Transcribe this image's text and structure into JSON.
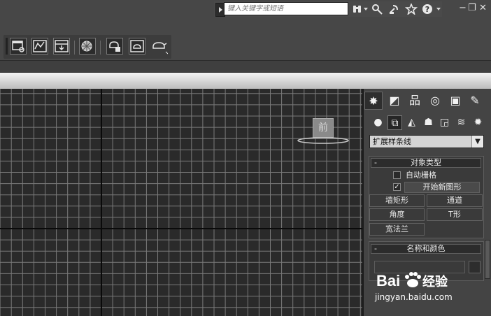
{
  "infocenter": {
    "search_placeholder": "键入关键字或短语",
    "icons": [
      "binoculars-icon",
      "key-icon",
      "satellite-icon",
      "star-icon",
      "help-icon"
    ],
    "help_glyph": "?"
  },
  "window_controls": {
    "minimize": "−",
    "restore": "❐",
    "close": "✕"
  },
  "toolbar": {
    "icons": [
      "scene-explorer-icon",
      "curve-editor-icon",
      "schematic-view-icon",
      "material-editor-icon",
      "render-setup-icon",
      "rendered-frame-icon",
      "render-icon"
    ]
  },
  "viewport": {
    "gizmo_label": "前",
    "background": "#2a2a2a",
    "grid_color": "#7a7a7a",
    "axis_color": "#0a0a0a"
  },
  "command_panel": {
    "tabs": [
      {
        "icon": "create-icon",
        "glyph": "✸"
      },
      {
        "icon": "modify-icon",
        "glyph": "◩"
      },
      {
        "icon": "hierarchy-icon",
        "glyph": "品"
      },
      {
        "icon": "motion-icon",
        "glyph": "◎"
      },
      {
        "icon": "display-icon",
        "glyph": "▣"
      },
      {
        "icon": "utilities-icon",
        "glyph": "✎"
      }
    ],
    "categories": [
      {
        "icon": "geometry-icon",
        "glyph": "●"
      },
      {
        "icon": "shapes-icon",
        "glyph": "⧉"
      },
      {
        "icon": "lights-icon",
        "glyph": "◭"
      },
      {
        "icon": "cameras-icon",
        "glyph": "☗"
      },
      {
        "icon": "helpers-icon",
        "glyph": "◲"
      },
      {
        "icon": "space-warps-icon",
        "glyph": "≋"
      },
      {
        "icon": "systems-icon",
        "glyph": "✹"
      }
    ],
    "dropdown_value": "扩展样条线",
    "dropdown_arrow": "▼",
    "object_type": {
      "title": "对象类型",
      "collapse": "-",
      "auto_grid_label": "自动栅格",
      "start_new_shape_label": "开始新图形",
      "start_new_shape_check": "✓",
      "buttons": [
        "墙矩形",
        "通道",
        "角度",
        "T形",
        "宽法兰"
      ]
    },
    "name_color": {
      "title": "名称和颜色",
      "collapse": "-"
    }
  },
  "watermark": {
    "logo_text": "Bai",
    "logo_suffix": "经验",
    "url": "jingyan.baidu.com"
  }
}
